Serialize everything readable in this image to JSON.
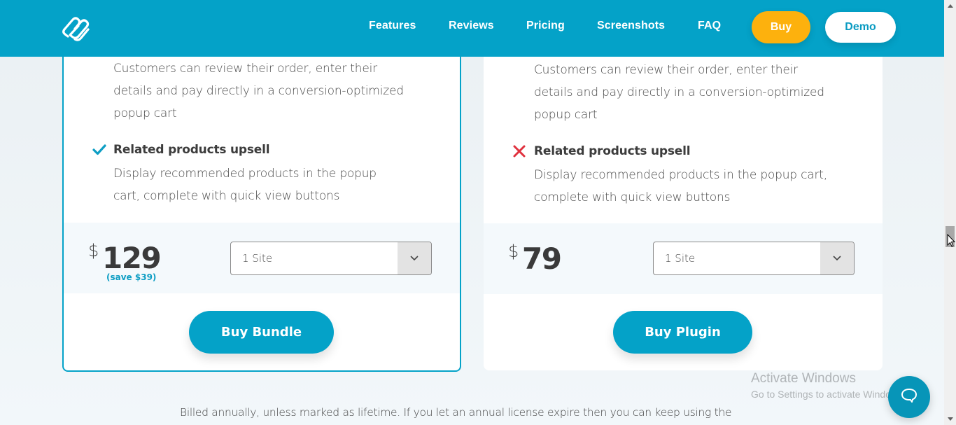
{
  "header": {
    "logo_label": "logo",
    "nav": [
      "Features",
      "Reviews",
      "Pricing",
      "Screenshots",
      "FAQ"
    ],
    "buy_label": "Buy",
    "demo_label": "Demo",
    "colors": {
      "brand": "#04a2c8",
      "buy": "#fdb10d"
    }
  },
  "plans": [
    {
      "features": [
        {
          "included": true,
          "title": "",
          "description_lines": [
            "Customers can review their order, enter their",
            "details and pay directly in a conversion-optimized",
            "popup cart"
          ]
        },
        {
          "included": true,
          "icon": "check-icon",
          "title": "Related products upsell",
          "description_lines": [
            "Display recommended products in the popup",
            "cart, complete with quick view buttons"
          ]
        }
      ],
      "currency": "$",
      "price": "129",
      "save_note": "(save $39)",
      "select_value": "1 Site",
      "cta_label": "Buy Bundle",
      "highlighted": true
    },
    {
      "features": [
        {
          "included": true,
          "title": "",
          "description_lines": [
            "Customers can review their order, enter their",
            "details and pay directly in a conversion-optimized",
            "popup cart"
          ]
        },
        {
          "included": false,
          "icon": "cross-icon",
          "title": "Related products upsell",
          "description_lines": [
            "Display recommended products in the popup cart,",
            "complete with quick view buttons"
          ]
        }
      ],
      "currency": "$",
      "price": "79",
      "save_note": "",
      "select_value": "1 Site",
      "cta_label": "Buy Plugin",
      "highlighted": false
    }
  ],
  "footnote": "Billed annually, unless marked as lifetime. If you let an annual license expire then you can keep using the",
  "os_overlay": {
    "activate_title": "Activate Windows",
    "activate_subtitle": "Go to Settings to activate Windows."
  },
  "colors": {
    "check": "#0e9ec4",
    "cross": "#e0313e",
    "save_note": "#0e9ec4"
  }
}
